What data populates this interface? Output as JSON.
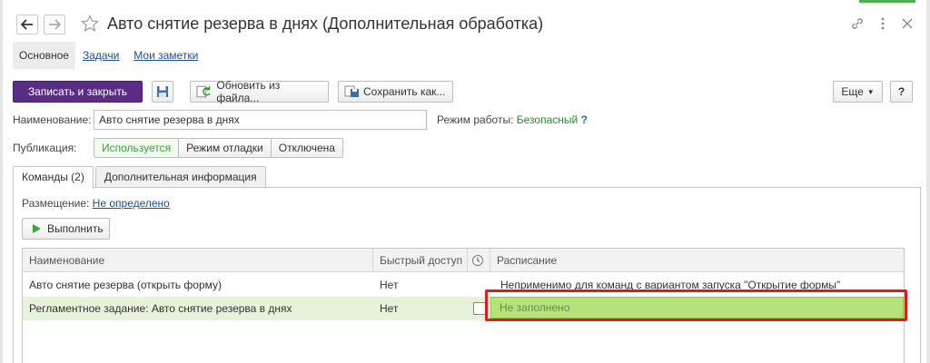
{
  "window": {
    "title": "Авто снятие резерва в днях (Дополнительная обработка)",
    "icons": [
      "back-arrow-icon",
      "forward-arrow-icon",
      "star-icon",
      "link-icon",
      "more-icon",
      "close-icon"
    ]
  },
  "top_tabs": [
    {
      "label": "Основное",
      "active": true
    },
    {
      "label": "Задачи",
      "active": false
    },
    {
      "label": "Мои заметки",
      "active": false
    }
  ],
  "toolbar": {
    "save_close": "Записать и закрыть",
    "update_file": "Обновить из файла...",
    "save_as": "Сохранить как...",
    "more": "Еще",
    "help": "?"
  },
  "form": {
    "name_label": "Наименование:",
    "name_value": "Авто снятие резерва в днях",
    "mode_label": "Режим работы:",
    "mode_value": "Безопасный",
    "mode_help": "?",
    "publication_label": "Публикация:",
    "publication_options": [
      "Используется",
      "Режим отладки",
      "Отключена"
    ],
    "publication_selected": "Используется"
  },
  "page_tabs": [
    {
      "label": "Команды (2)",
      "active": true
    },
    {
      "label": "Дополнительная информация",
      "active": false
    }
  ],
  "commands": {
    "placement_label": "Размещение:",
    "placement_value": "Не определено",
    "run_button": "Выполнить",
    "columns": [
      "Наименование",
      "Быстрый доступ",
      "clock-icon",
      "Расписание"
    ],
    "rows": [
      {
        "name": "Авто снятие резерва (открыть форму)",
        "quick": "Нет",
        "schedule": "Неприменимо для команд с вариантом запуска \"Открытие формы\"",
        "selected": false
      },
      {
        "name": "Регламентное задание: Авто снятие резерва в днях",
        "quick": "Нет",
        "schedule": "Не заполнено",
        "selected": true
      }
    ]
  },
  "colors": {
    "primary": "#5b2c83",
    "selected_row": "#e6f2d9",
    "highlight_cell": "#b5e27a",
    "annotation_red": "#e01b1b",
    "active_green": "#3aa63a"
  }
}
